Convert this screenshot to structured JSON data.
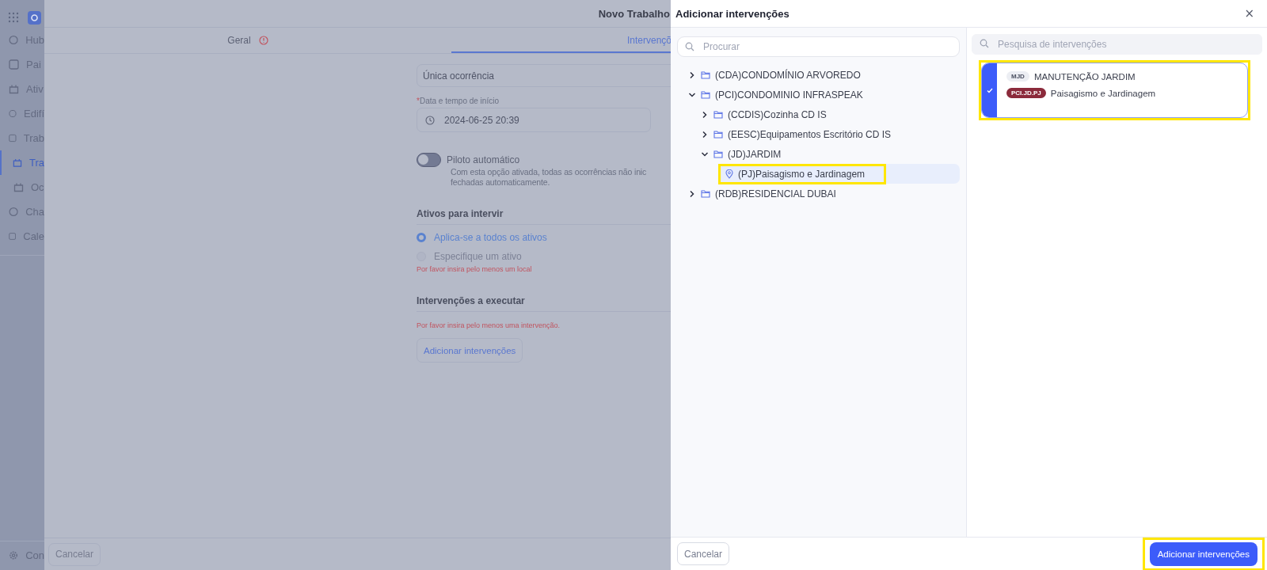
{
  "sidebar": {
    "items": [
      {
        "label": "Hub",
        "selected": false
      },
      {
        "label": "Pai",
        "selected": false
      },
      {
        "label": "Ativ",
        "selected": false
      },
      {
        "label": "Edifí",
        "selected": false
      },
      {
        "label": "Trab",
        "selected": false
      },
      {
        "label": "Tra",
        "selected": true,
        "children": [
          {
            "label": "Oc",
            "selected": false
          }
        ]
      },
      {
        "label": "Cha",
        "selected": false
      },
      {
        "label": "Cale",
        "selected": false
      }
    ],
    "footer_item": "Con"
  },
  "page": {
    "title": "Novo Trabalho",
    "tabs": [
      {
        "label": "Geral",
        "selected": false,
        "error": true
      },
      {
        "label": "Intervençõ",
        "selected": true,
        "error": false
      }
    ],
    "recurrence": {
      "value": "Única ocorrência"
    },
    "start": {
      "label": "Data e tempo de início",
      "required_mark": "*",
      "value": "2024-06-25 20:39"
    },
    "autopilot": {
      "label": "Piloto automático",
      "on": false,
      "description": [
        "Com esta opção ativada, todas as ocorrências não inic",
        "fechadas automaticamente."
      ]
    },
    "assets": {
      "heading": "Ativos para intervir",
      "options": [
        {
          "label": "Aplica-se a todos os ativos",
          "selected": true,
          "disabled": false
        },
        {
          "label": "Especifique um ativo",
          "selected": false,
          "disabled": true
        }
      ],
      "error": "Por favor insira pelo menos um local"
    },
    "interventions": {
      "heading": "Intervenções a executar",
      "error": "Por favor insira pelo menos uma intervenção.",
      "button": "Adicionar intervenções"
    },
    "cancel": "Cancelar"
  },
  "modal": {
    "title": "Adicionar intervenções",
    "close": "×",
    "search": {
      "placeholder": "Procurar"
    },
    "tree": [
      {
        "label": "(CDA)CONDOMÍNIO ARVOREDO",
        "kind": "folder",
        "expanded": false
      },
      {
        "label": "(PCI)CONDOMINIO INFRASPEAK",
        "kind": "folder",
        "expanded": true,
        "children": [
          {
            "label": "(CCDIS)Cozinha CD IS",
            "kind": "folder",
            "expanded": false
          },
          {
            "label": "(EESC)Equipamentos Escritório CD IS",
            "kind": "folder",
            "expanded": false
          },
          {
            "label": "(JD)JARDIM",
            "kind": "folder",
            "expanded": true,
            "children": [
              {
                "label": "(PJ)Paisagismo e Jardinagem",
                "kind": "location",
                "selected": true,
                "highlighted": true
              }
            ]
          }
        ]
      },
      {
        "label": "(RDB)RESIDENCIAL DUBAI",
        "kind": "folder",
        "expanded": false
      }
    ],
    "intervention_search": {
      "placeholder": "Pesquisa de intervenções"
    },
    "cards": [
      {
        "code": "MJD",
        "name": "MANUTENÇÃO JARDIM",
        "location_code": "PCI.JD.PJ",
        "location": "Paisagismo e Jardinagem",
        "checked": true,
        "highlighted": true
      }
    ],
    "cancel": "Cancelar",
    "confirm": {
      "label": "Adicionar intervenções",
      "highlighted": true
    }
  }
}
